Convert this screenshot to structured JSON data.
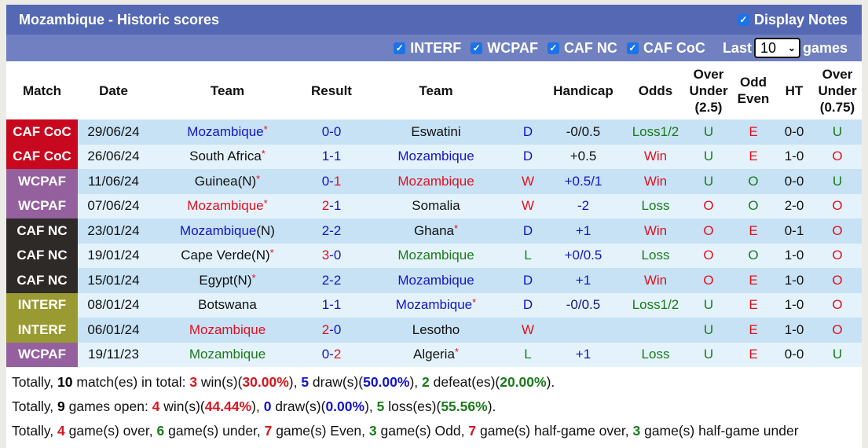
{
  "header": {
    "title": "Mozambique - Historic scores",
    "display_notes_label": "Display Notes",
    "display_notes_checked": true
  },
  "filters": {
    "items": [
      {
        "label": "INTERF",
        "checked": true
      },
      {
        "label": "WCPAF",
        "checked": true
      },
      {
        "label": "CAF NC",
        "checked": true
      },
      {
        "label": "CAF CoC",
        "checked": true
      }
    ],
    "last_label": "Last",
    "last_value": "10",
    "games_label": "games",
    "check_glyph": "✓",
    "chevron_glyph": "⌄"
  },
  "columns": {
    "match": "Match",
    "date": "Date",
    "home": "Team",
    "result": "Result",
    "away": "Team",
    "handicap": "Handicap",
    "odds": "Odds",
    "ou_1": "Over",
    "ou_2": "Under",
    "ou_3": "(2.5)",
    "oe_1": "Odd",
    "oe_2": "Even",
    "ht": "HT",
    "hou_1": "Over",
    "hou_2": "Under",
    "hou_3": "(0.75)"
  },
  "league_colors": {
    "CAF CoC": "#c8081e",
    "WCPAF": "#94609e",
    "CAF NC": "#2e2a28",
    "INTERF": "#9a9a32"
  },
  "rows": [
    {
      "league": "CAF CoC",
      "date": "29/06/24",
      "home": "Mozambique",
      "home_color": "blue",
      "home_star": true,
      "home_n": "",
      "score_h": "0",
      "score_a": "0",
      "score_h_color": "blue",
      "score_a_color": "blue",
      "away": "Eswatini",
      "away_color": "dark",
      "away_star": false,
      "wdl": "D",
      "wdl_color": "blue",
      "handicap": "-0/0.5",
      "handicap_color": "dark",
      "odds": "Loss1/2",
      "odds_color": "green",
      "ou": "U",
      "ou_color": "green",
      "oe": "E",
      "oe_color": "red",
      "ht": "0-0",
      "hou": "U",
      "hou_color": "green"
    },
    {
      "league": "CAF CoC",
      "date": "26/06/24",
      "home": "South Africa",
      "home_color": "dark",
      "home_star": true,
      "home_n": "",
      "score_h": "1",
      "score_a": "1",
      "score_h_color": "blue",
      "score_a_color": "blue",
      "away": "Mozambique",
      "away_color": "blue",
      "away_star": false,
      "wdl": "D",
      "wdl_color": "blue",
      "handicap": "+0.5",
      "handicap_color": "dark",
      "odds": "Win",
      "odds_color": "red",
      "ou": "U",
      "ou_color": "green",
      "oe": "E",
      "oe_color": "red",
      "ht": "1-0",
      "hou": "O",
      "hou_color": "red"
    },
    {
      "league": "WCPAF",
      "date": "11/06/24",
      "home": "Guinea(N)",
      "home_color": "dark",
      "home_star": true,
      "home_n": "",
      "score_h": "0",
      "score_a": "1",
      "score_h_color": "blue",
      "score_a_color": "red",
      "away": "Mozambique",
      "away_color": "red",
      "away_star": false,
      "wdl": "W",
      "wdl_color": "red",
      "handicap": "+0.5/1",
      "handicap_color": "blue",
      "odds": "Win",
      "odds_color": "red",
      "ou": "U",
      "ou_color": "green",
      "oe": "O",
      "oe_color": "green",
      "ht": "0-0",
      "hou": "U",
      "hou_color": "green"
    },
    {
      "league": "WCPAF",
      "date": "07/06/24",
      "home": "Mozambique",
      "home_color": "red",
      "home_star": true,
      "home_n": "",
      "score_h": "2",
      "score_a": "1",
      "score_h_color": "red",
      "score_a_color": "blue",
      "away": "Somalia",
      "away_color": "dark",
      "away_star": false,
      "wdl": "W",
      "wdl_color": "red",
      "handicap": "-2",
      "handicap_color": "blue",
      "odds": "Loss",
      "odds_color": "green",
      "ou": "O",
      "ou_color": "red",
      "oe": "O",
      "oe_color": "green",
      "ht": "2-0",
      "hou": "O",
      "hou_color": "red"
    },
    {
      "league": "CAF NC",
      "date": "23/01/24",
      "home": "Mozambique",
      "home_color": "blue",
      "home_star": false,
      "home_n": "(N)",
      "score_h": "2",
      "score_a": "2",
      "score_h_color": "blue",
      "score_a_color": "blue",
      "away": "Ghana",
      "away_color": "dark",
      "away_star": true,
      "wdl": "D",
      "wdl_color": "blue",
      "handicap": "+1",
      "handicap_color": "blue",
      "odds": "Win",
      "odds_color": "red",
      "ou": "O",
      "ou_color": "red",
      "oe": "E",
      "oe_color": "red",
      "ht": "0-1",
      "hou": "O",
      "hou_color": "red"
    },
    {
      "league": "CAF NC",
      "date": "19/01/24",
      "home": "Cape Verde(N)",
      "home_color": "dark",
      "home_star": true,
      "home_n": "",
      "score_h": "3",
      "score_a": "0",
      "score_h_color": "red",
      "score_a_color": "blue",
      "away": "Mozambique",
      "away_color": "green",
      "away_star": false,
      "wdl": "L",
      "wdl_color": "green",
      "handicap": "+0/0.5",
      "handicap_color": "blue",
      "odds": "Loss",
      "odds_color": "green",
      "ou": "O",
      "ou_color": "red",
      "oe": "O",
      "oe_color": "green",
      "ht": "1-0",
      "hou": "O",
      "hou_color": "red"
    },
    {
      "league": "CAF NC",
      "date": "15/01/24",
      "home": "Egypt(N)",
      "home_color": "dark",
      "home_star": true,
      "home_n": "",
      "score_h": "2",
      "score_a": "2",
      "score_h_color": "blue",
      "score_a_color": "blue",
      "away": "Mozambique",
      "away_color": "blue",
      "away_star": false,
      "wdl": "D",
      "wdl_color": "blue",
      "handicap": "+1",
      "handicap_color": "blue",
      "odds": "Win",
      "odds_color": "red",
      "ou": "O",
      "ou_color": "red",
      "oe": "E",
      "oe_color": "red",
      "ht": "1-0",
      "hou": "O",
      "hou_color": "red"
    },
    {
      "league": "INTERF",
      "date": "08/01/24",
      "home": "Botswana",
      "home_color": "dark",
      "home_star": false,
      "home_n": "",
      "score_h": "1",
      "score_a": "1",
      "score_h_color": "blue",
      "score_a_color": "blue",
      "away": "Mozambique",
      "away_color": "blue",
      "away_star": true,
      "wdl": "D",
      "wdl_color": "blue",
      "handicap": "-0/0.5",
      "handicap_color": "navy",
      "odds": "Loss1/2",
      "odds_color": "green",
      "ou": "U",
      "ou_color": "green",
      "oe": "E",
      "oe_color": "red",
      "ht": "1-0",
      "hou": "O",
      "hou_color": "red"
    },
    {
      "league": "INTERF",
      "date": "06/01/24",
      "home": "Mozambique",
      "home_color": "red",
      "home_star": false,
      "home_n": "",
      "score_h": "2",
      "score_a": "0",
      "score_h_color": "red",
      "score_a_color": "blue",
      "away": "Lesotho",
      "away_color": "dark",
      "away_star": false,
      "wdl": "W",
      "wdl_color": "red",
      "handicap": "",
      "handicap_color": "dark",
      "odds": "",
      "odds_color": "dark",
      "ou": "U",
      "ou_color": "green",
      "oe": "E",
      "oe_color": "red",
      "ht": "1-0",
      "hou": "O",
      "hou_color": "red"
    },
    {
      "league": "WCPAF",
      "date": "19/11/23",
      "home": "Mozambique",
      "home_color": "green",
      "home_star": false,
      "home_n": "",
      "score_h": "0",
      "score_a": "2",
      "score_h_color": "blue",
      "score_a_color": "red",
      "away": "Algeria",
      "away_color": "dark",
      "away_star": true,
      "wdl": "L",
      "wdl_color": "green",
      "handicap": "+1",
      "handicap_color": "blue",
      "odds": "Loss",
      "odds_color": "green",
      "ou": "U",
      "ou_color": "green",
      "oe": "E",
      "oe_color": "red",
      "ht": "0-0",
      "hou": "U",
      "hou_color": "green"
    }
  ],
  "summary": {
    "line1": {
      "prefix": "Totally, ",
      "total": "10",
      "t1": " match(es) in total: ",
      "wins": "3",
      "t2": " win(s)(",
      "win_pct": "30.00%",
      "t3": "), ",
      "draws": "5",
      "t4": " draw(s)(",
      "draw_pct": "50.00%",
      "t5": "), ",
      "defeats": "2",
      "t6": " defeat(es)(",
      "defeat_pct": "20.00%",
      "t7": ")."
    },
    "line2": {
      "prefix": "Totally, ",
      "open": "9",
      "t1": " games open: ",
      "wins": "4",
      "t2": " win(s)(",
      "win_pct": "44.44%",
      "t3": "), ",
      "draws": "0",
      "t4": " draw(s)(",
      "draw_pct": "0.00%",
      "t5": "), ",
      "losses": "5",
      "t6": " loss(es)(",
      "loss_pct": "55.56%",
      "t7": ")."
    },
    "line3": {
      "prefix": "Totally, ",
      "over": "4",
      "t1": " game(s) over, ",
      "under": "6",
      "t2": " game(s) under, ",
      "even": "7",
      "t3": " game(s) Even, ",
      "odd": "3",
      "t4": " game(s) Odd, ",
      "half_over": "7",
      "t5": " game(s) half-game over, ",
      "half_under": "3",
      "t6": " game(s) half-game under"
    }
  }
}
